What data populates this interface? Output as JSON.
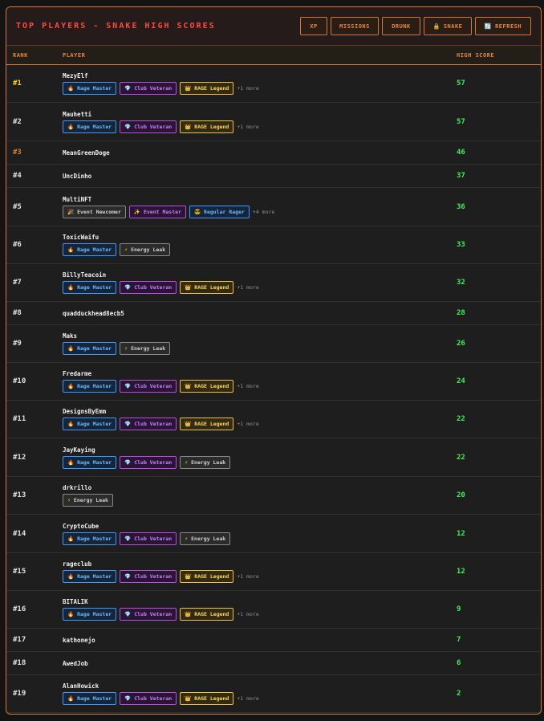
{
  "header": {
    "title": "TOP PLAYERS - SNAKE HIGH SCORES"
  },
  "toolbar": {
    "xp": "XP",
    "missions": "MISSIONS",
    "drunk": "DRUNK",
    "snake": "SNAKE",
    "refresh": "REFRESH"
  },
  "columns": {
    "rank": "RANK",
    "player": "PLAYER",
    "score": "HIGH SCORE"
  },
  "rows": [
    {
      "rank": "#1",
      "name": "MezyElf",
      "score": "57",
      "more": "+1 more"
    },
    {
      "rank": "#2",
      "name": "Mauhetti",
      "score": "57",
      "more": "+1 more"
    },
    {
      "rank": "#3",
      "name": "MeanGreenDoge",
      "score": "46"
    },
    {
      "rank": "#4",
      "name": "UncDinho",
      "score": "37"
    },
    {
      "rank": "#5",
      "name": "MultiNFT",
      "score": "36",
      "more": "+4 more"
    },
    {
      "rank": "#6",
      "name": "ToxicWaifu",
      "score": "33"
    },
    {
      "rank": "#7",
      "name": "BillyTeacoin",
      "score": "32",
      "more": "+1 more"
    },
    {
      "rank": "#8",
      "name": "quadduckhead8ecb5",
      "score": "28"
    },
    {
      "rank": "#9",
      "name": "Maks",
      "score": "26"
    },
    {
      "rank": "#10",
      "name": "Fredarme",
      "score": "24",
      "more": "+1 more"
    },
    {
      "rank": "#11",
      "name": "DesignsByEmm",
      "score": "22",
      "more": "+1 more"
    },
    {
      "rank": "#12",
      "name": "JayKaying",
      "score": "22"
    },
    {
      "rank": "#13",
      "name": "drkrillo",
      "score": "20"
    },
    {
      "rank": "#14",
      "name": "CryptoCube",
      "score": "12"
    },
    {
      "rank": "#15",
      "name": "rageclub",
      "score": "12",
      "more": "+1 more"
    },
    {
      "rank": "#16",
      "name": "BITALIK",
      "score": "9",
      "more": "+1 more"
    },
    {
      "rank": "#17",
      "name": "kathonejo",
      "score": "7"
    },
    {
      "rank": "#18",
      "name": "AwedJob",
      "score": "6"
    },
    {
      "rank": "#19",
      "name": "AlanHowick",
      "score": "2",
      "more": "+1 more"
    }
  ],
  "badges": {
    "rage_master": "Rage Master",
    "club_veteran": "Club Veteran",
    "rage_legend": "RAGE Legend",
    "energy_leak": "Energy Leak",
    "event_newcomer": "Event Newcomer",
    "event_master": "Event Master",
    "regular_rager": "Regular Rager"
  },
  "icons": {
    "rage_master": "flame-icon",
    "club_veteran": "gem-icon",
    "rage_legend": "crown-icon",
    "energy_leak": "lightning-icon",
    "event_newcomer": "party-icon",
    "event_master": "sparkle-icon",
    "regular_rager": "face-icon",
    "snake": "lock-icon",
    "refresh": "refresh-icon"
  },
  "colors": {
    "accent": "#d9772b",
    "title": "#ff4a3d",
    "score": "#3cf060",
    "rank1": "#ffd400",
    "rank3": "#e07a2a"
  }
}
